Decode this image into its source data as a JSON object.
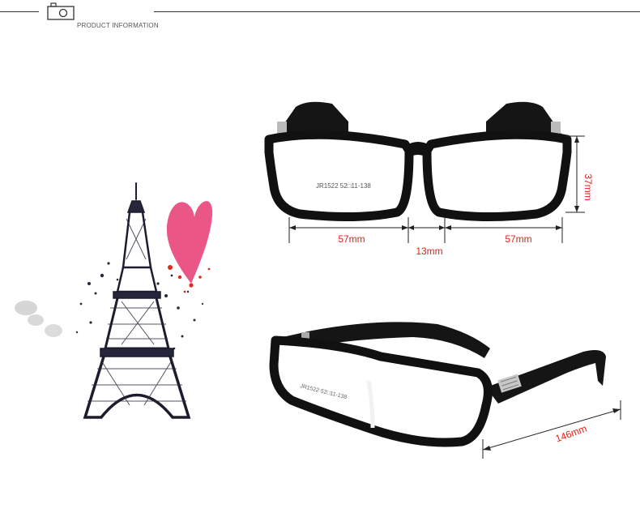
{
  "header": {
    "title": "PRODUCT INFORMATION",
    "icon": "camera-icon"
  },
  "dimensions": {
    "lens_width_left": "57mm",
    "bridge_width": "13mm",
    "lens_width_right": "57mm",
    "lens_height": "37mm",
    "temple_length": "146mm"
  },
  "frame_imprint": "JR1522 52□11-138",
  "colors": {
    "dimension_text": "#e0201a",
    "heart": "#e8457a",
    "frame": "#111111"
  }
}
